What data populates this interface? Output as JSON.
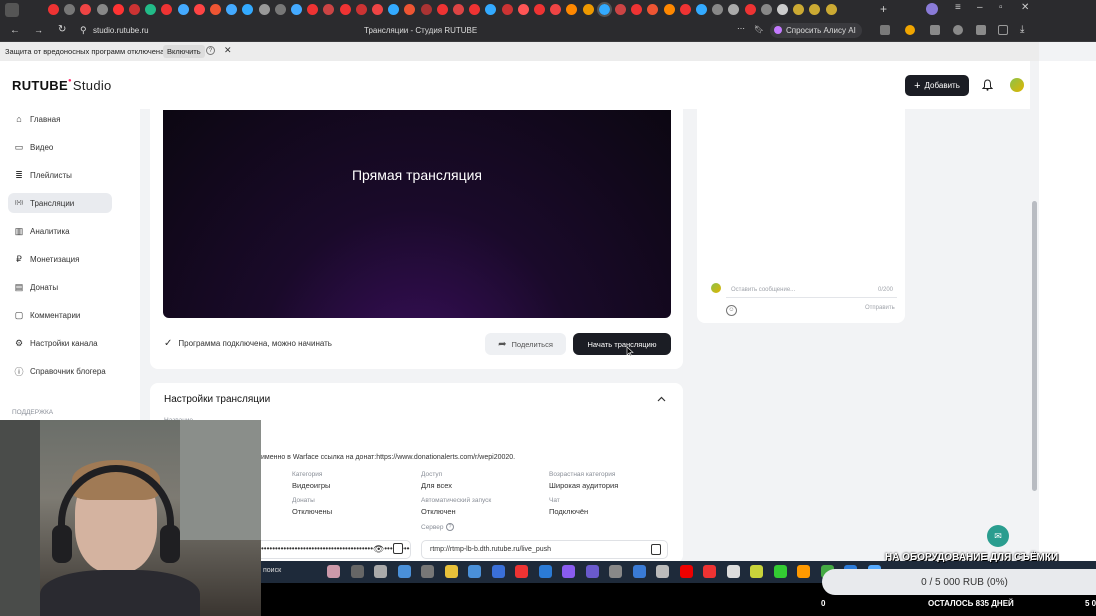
{
  "browser": {
    "address": "studio.rutube.ru",
    "tab_title": "Трансляции - Студия RUTUBE",
    "alice_label": "Спросить Алису AI",
    "infobar_text": "Защита от вредоносных программ отключена",
    "infobar_action": "Включить"
  },
  "header": {
    "logo_main": "RUTUBE",
    "logo_studio": "Studio",
    "add_button": "Добавить"
  },
  "sidebar": {
    "items": [
      {
        "label": "Главная",
        "icon": "home-icon"
      },
      {
        "label": "Видео",
        "icon": "video-icon"
      },
      {
        "label": "Плейлисты",
        "icon": "playlist-icon"
      },
      {
        "label": "Трансляции",
        "icon": "broadcast-icon"
      },
      {
        "label": "Аналитика",
        "icon": "analytics-icon"
      },
      {
        "label": "Монетизация",
        "icon": "monetization-icon"
      },
      {
        "label": "Донаты",
        "icon": "donate-icon"
      },
      {
        "label": "Комментарии",
        "icon": "comments-icon"
      },
      {
        "label": "Настройки канала",
        "icon": "settings-icon"
      },
      {
        "label": "Справочник блогера",
        "icon": "info-icon"
      }
    ],
    "section": "ПОДДЕРЖКА"
  },
  "player": {
    "title": "Прямая трансляция"
  },
  "status": {
    "text": "Программа подключена, можно начинать",
    "share_button": "Поделиться",
    "start_button": "Начать трансляцию"
  },
  "chat": {
    "placeholder": "Оставить сообщение...",
    "counter": "0/200",
    "send": "Отправить"
  },
  "settings": {
    "title": "Настройки трансляции",
    "name_label": "Название",
    "description": "именно в Warface ссылка на донат:https://www.donationalerts.com/r/wepi20020.",
    "fields": [
      {
        "label": "Категория",
        "value": "Видеоигры"
      },
      {
        "label": "Доступ",
        "value": "Для всех"
      },
      {
        "label": "Возрастная категория",
        "value": "Широкая аудитория"
      },
      {
        "label": "Донаты",
        "value": "Отключены"
      },
      {
        "label": "Автоматический запуск",
        "value": "Отключен"
      },
      {
        "label": "Чат",
        "value": "Подключён"
      }
    ],
    "server_label": "Сервер",
    "stream_key_mask": "••••••••••••••••••••••••••••••••••••••••••••••••••••••",
    "server_url": "rtmp://rtmp-lb-b.dth.rutube.ru/live_push"
  },
  "overlay": {
    "goal_title": "НА ОБОРУДОВАНИЕ ДЛЯ СЪЁМКИ",
    "goal_progress": "0 / 5 000 RUB (0%)",
    "goal_fraction": 0,
    "bottom_left": "0",
    "bottom_days": "ОСТАЛОСЬ 835 ДНЕЙ",
    "bottom_right": "5 0"
  },
  "taskbar": {
    "search": "поиск"
  }
}
